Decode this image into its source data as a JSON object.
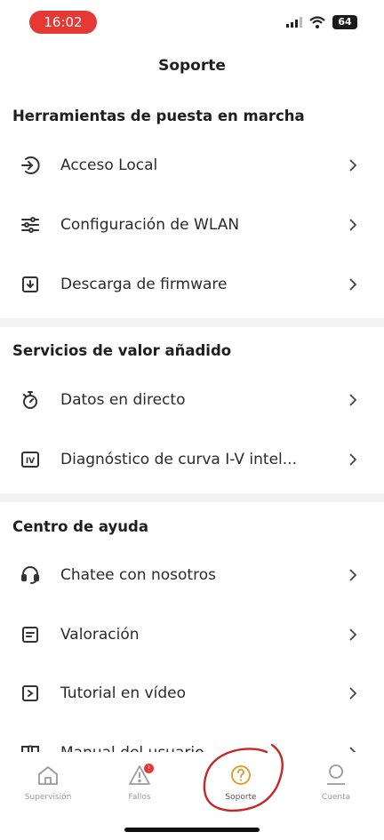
{
  "status": {
    "time": "16:02",
    "battery": "64"
  },
  "header": {
    "title": "Soporte"
  },
  "sections": [
    {
      "title": "Herramientas de puesta en marcha",
      "items": [
        {
          "label": "Acceso Local",
          "icon": "login-arrow-icon"
        },
        {
          "label": "Configuración de WLAN",
          "icon": "sliders-icon"
        },
        {
          "label": "Descarga de firmware",
          "icon": "download-box-icon"
        }
      ]
    },
    {
      "title": "Servicios de valor añadido",
      "items": [
        {
          "label": "Datos en directo",
          "icon": "stopwatch-icon"
        },
        {
          "label": "Diagnóstico de curva I-V intel...",
          "icon": "iv-curve-icon"
        }
      ]
    },
    {
      "title": "Centro de ayuda",
      "items": [
        {
          "label": "Chatee con nosotros",
          "icon": "headset-icon"
        },
        {
          "label": "Valoración",
          "icon": "feedback-icon"
        },
        {
          "label": "Tutorial en vídeo",
          "icon": "video-icon"
        },
        {
          "label": "Manual del usuario",
          "icon": "book-icon"
        }
      ]
    }
  ],
  "tabbar": {
    "tabs": [
      {
        "label": "Supervisión"
      },
      {
        "label": "Fallos"
      },
      {
        "label": "Soporte"
      },
      {
        "label": "Cuenta"
      }
    ],
    "fallos_badge": "!"
  },
  "colors": {
    "accent": "#e53935",
    "divider": "#f3f3f3"
  }
}
